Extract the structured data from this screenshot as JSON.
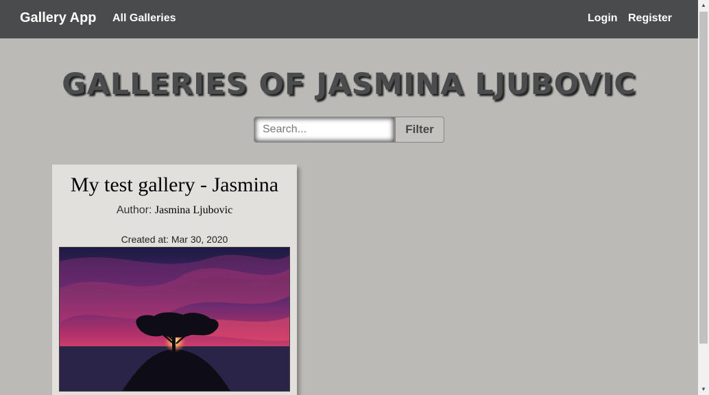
{
  "navbar": {
    "brand": "Gallery App",
    "all_galleries": "All Galleries",
    "login": "Login",
    "register": "Register",
    "bg_color": "#494b4d"
  },
  "header": {
    "title": "GALLERIES OF JASMINA LJUBOVIC"
  },
  "search": {
    "placeholder": "Search...",
    "value": "",
    "filter_label": "Filter"
  },
  "galleries": [
    {
      "title": "My test gallery - Jasmina",
      "author_label": "Author:",
      "author_name": "Jasmina Ljubovic",
      "created_label": "Created at:",
      "created_date": "Mar 30, 2020",
      "image_icon": "tree-sunset-image"
    }
  ],
  "colors": {
    "page_bg": "#bbbab6",
    "card_bg": "#e1e0dc"
  }
}
